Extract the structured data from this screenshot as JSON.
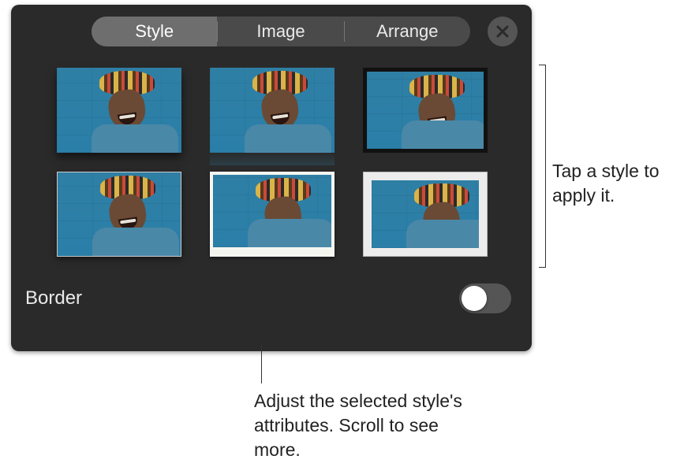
{
  "tabs": {
    "style": "Style",
    "image": "Image",
    "arrange": "Arrange",
    "selected": "style"
  },
  "styles": [
    {
      "variant": "shadow"
    },
    {
      "variant": "reflect"
    },
    {
      "variant": "frame-black"
    },
    {
      "variant": "frame-thin"
    },
    {
      "variant": "polaroid"
    },
    {
      "variant": "mat"
    }
  ],
  "border": {
    "label": "Border",
    "on": false
  },
  "callouts": {
    "right": "Tap a style to apply it.",
    "bottom": "Adjust the selected style's attributes. Scroll to see more."
  }
}
